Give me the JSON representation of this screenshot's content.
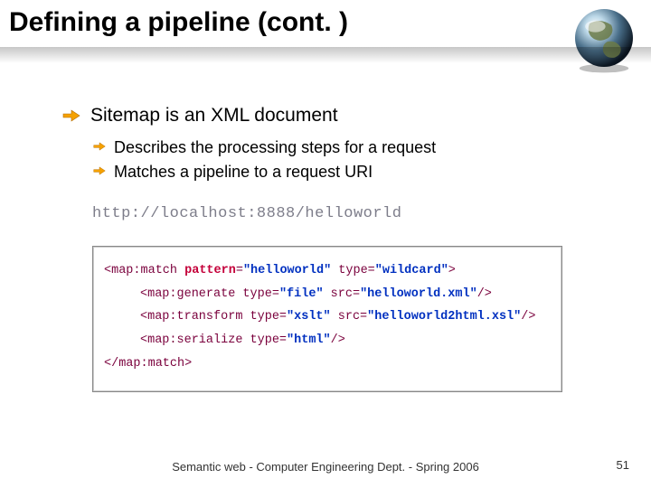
{
  "title": "Defining a pipeline (cont. )",
  "bullets": {
    "main": "Sitemap is an XML document",
    "sub1": "Describes the processing steps for a request",
    "sub2": "Matches a pipeline to a request URI"
  },
  "url": "http://localhost:8888/helloworld",
  "code": {
    "l1": {
      "t1": "<map:match ",
      "a1": "pattern",
      "e1": "=",
      "v1": "\"helloworld\"",
      "t2": " type=",
      "v2": "\"wildcard\"",
      "t3": ">"
    },
    "l2": {
      "t1": "<map:generate  type=",
      "v1": "\"file\"",
      "t2": " src=",
      "v2": "\"helloworld.xml\"",
      "t3": "/>"
    },
    "l3": {
      "t1": "<map:transform type=",
      "v1": "\"xslt\"",
      "t2": " src=",
      "v2": "\"helloworld2html.xsl\"",
      "t3": "/>"
    },
    "l4": {
      "t1": "<map:serialize type=",
      "v1": "\"html\"",
      "t2": "/>"
    },
    "l5": {
      "t1": "</map:match>"
    }
  },
  "footer": "Semantic web - Computer Engineering Dept. - Spring 2006",
  "page": "51"
}
